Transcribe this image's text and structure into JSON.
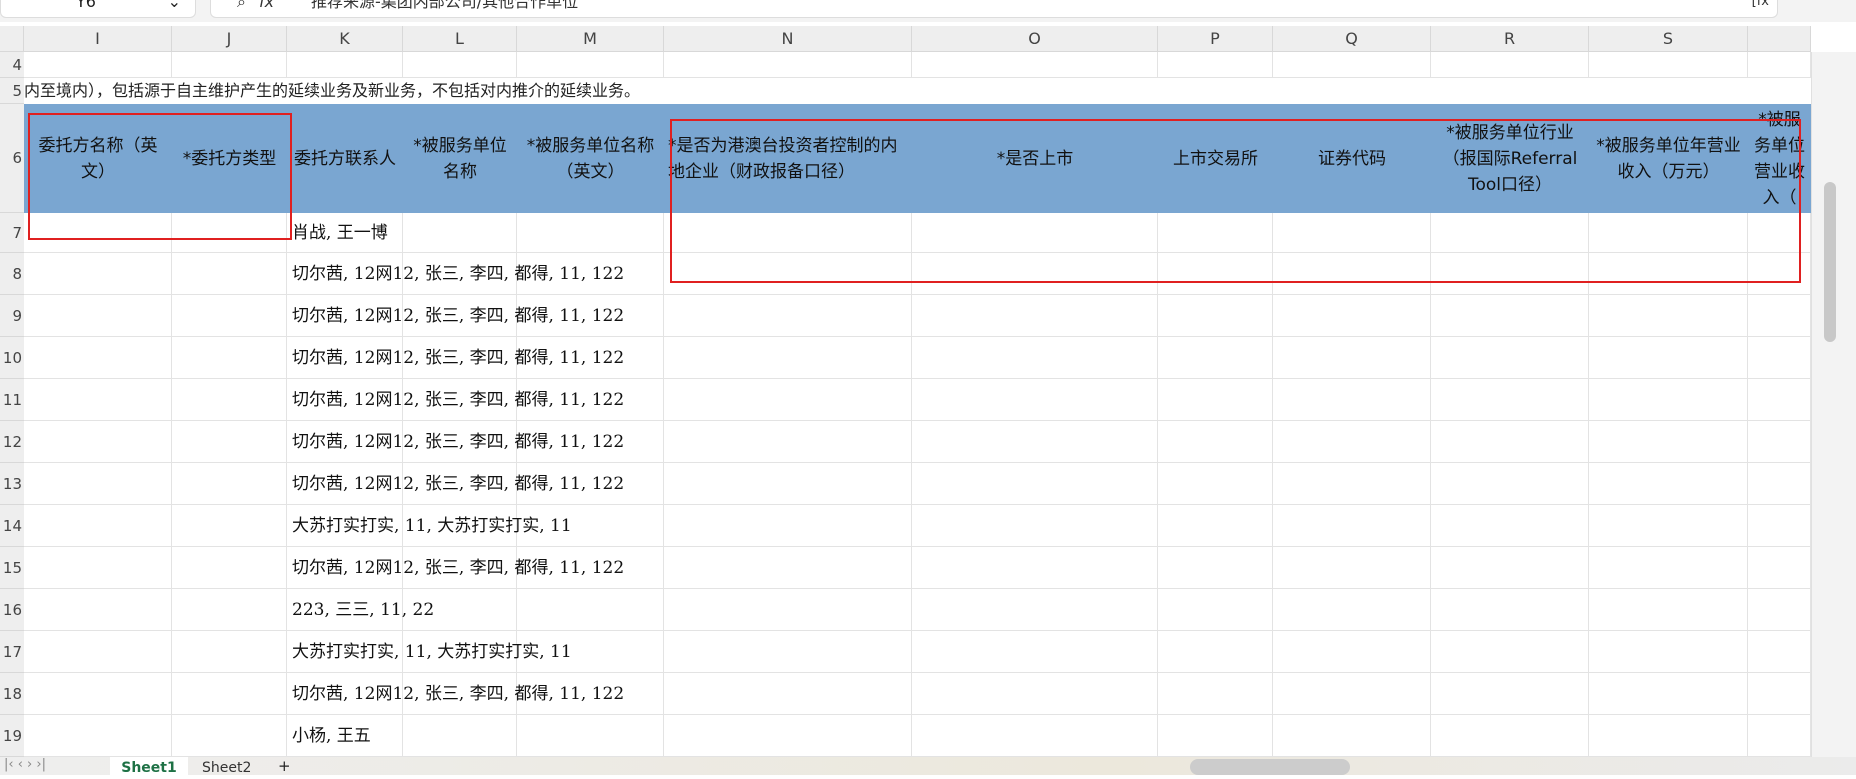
{
  "formula_bar": {
    "name_box": "Y6",
    "formula": "推荐来源-集团内部公司/其他合作单位",
    "fx": "fx"
  },
  "columns": [
    "I",
    "J",
    "K",
    "L",
    "M",
    "N",
    "O",
    "P",
    "Q",
    "R",
    "S"
  ],
  "row_numbers": [
    "4",
    "5",
    "6",
    "7",
    "8",
    "9",
    "10",
    "11",
    "12",
    "13",
    "14",
    "15",
    "16",
    "17",
    "18",
    "19"
  ],
  "row5_text": "内至境内），包括源于自主维护产生的延续业务及新业务，不包括对内推介的延续业务。",
  "headers": [
    "委托方名称（英文）",
    "*委托方类型",
    "委托方联系人",
    "*被服务单位名称",
    "*被服务单位名称（英文）",
    "*是否为港澳台投资者控制的内地企业（财政报备口径）",
    "*是否上市",
    "上市交易所",
    "证券代码",
    "*被服务单位行业（报国际Referral Tool口径）",
    "*被服务单位年营业收入（万元）",
    "*被服务单位营业收入（"
  ],
  "contacts": [
    "肖战, 王一博",
    "切尔茜, 12网12, 张三, 李四, 都得, 11, 122",
    "切尔茜, 12网12, 张三, 李四, 都得, 11, 122",
    "切尔茜, 12网12, 张三, 李四, 都得, 11, 122",
    "切尔茜, 12网12, 张三, 李四, 都得, 11, 122",
    "切尔茜, 12网12, 张三, 李四, 都得, 11, 122",
    "切尔茜, 12网12, 张三, 李四, 都得, 11, 122",
    "大苏打实打实, 11, 大苏打实打实, 11",
    "切尔茜, 12网12, 张三, 李四, 都得, 11, 122",
    "223, 三三, 11, 22",
    "大苏打实打实, 11, 大苏打实打实, 11",
    "切尔茜, 12网12, 张三, 李四, 都得, 11, 122",
    "小杨, 王五"
  ],
  "sheets": [
    "Sheet1",
    "Sheet2"
  ],
  "colors": {
    "header_fill": "#7aa6d1",
    "highlight_box": "#e02020",
    "active_tab": "#1e7145"
  }
}
